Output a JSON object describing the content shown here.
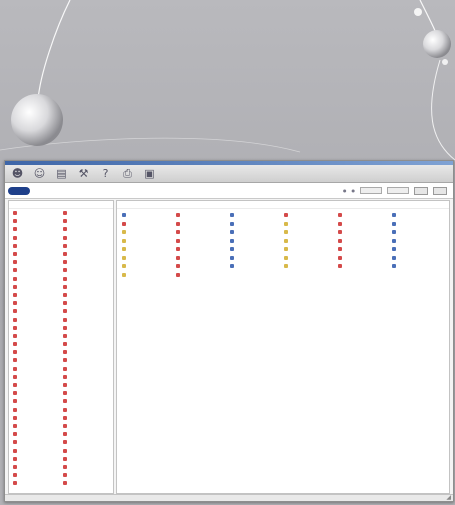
{
  "colors": {
    "red_icon": "#d44a4a",
    "blue_icon": "#4a6fb8",
    "yellow_icon": "#d8b94a",
    "title_bar": "#3e66a8"
  },
  "toolbar": {
    "icons": [
      "user-icon",
      "users-icon",
      "folder-icon",
      "tools-icon",
      "help-icon",
      "printer-icon",
      "building-icon"
    ]
  },
  "header": {
    "logo_text": "",
    "app_title": ""
  },
  "left_panel": {
    "col1": [
      {
        "color": "red"
      },
      {
        "color": "red"
      },
      {
        "color": "red"
      },
      {
        "color": "red"
      },
      {
        "color": "red"
      },
      {
        "color": "red"
      },
      {
        "color": "red"
      },
      {
        "color": "red"
      },
      {
        "color": "red"
      },
      {
        "color": "red"
      },
      {
        "color": "red"
      },
      {
        "color": "red"
      },
      {
        "color": "red"
      },
      {
        "color": "red"
      },
      {
        "color": "red"
      },
      {
        "color": "red"
      },
      {
        "color": "red"
      },
      {
        "color": "red"
      },
      {
        "color": "red"
      },
      {
        "color": "red"
      },
      {
        "color": "red"
      },
      {
        "color": "red"
      },
      {
        "color": "red"
      },
      {
        "color": "red"
      },
      {
        "color": "red"
      },
      {
        "color": "red"
      },
      {
        "color": "red"
      },
      {
        "color": "red"
      },
      {
        "color": "red"
      },
      {
        "color": "red"
      },
      {
        "color": "red"
      },
      {
        "color": "red"
      },
      {
        "color": "red"
      },
      {
        "color": "red"
      }
    ],
    "col2": [
      {
        "color": "red"
      },
      {
        "color": "red"
      },
      {
        "color": "red"
      },
      {
        "color": "red"
      },
      {
        "color": "red"
      },
      {
        "color": "red"
      },
      {
        "color": "red"
      },
      {
        "color": "red"
      },
      {
        "color": "red"
      },
      {
        "color": "red"
      },
      {
        "color": "red"
      },
      {
        "color": "red"
      },
      {
        "color": "red"
      },
      {
        "color": "red"
      },
      {
        "color": "red"
      },
      {
        "color": "red"
      },
      {
        "color": "red"
      },
      {
        "color": "red"
      },
      {
        "color": "red"
      },
      {
        "color": "red"
      },
      {
        "color": "red"
      },
      {
        "color": "red"
      },
      {
        "color": "red"
      },
      {
        "color": "red"
      },
      {
        "color": "red"
      },
      {
        "color": "red"
      },
      {
        "color": "red"
      },
      {
        "color": "red"
      },
      {
        "color": "red"
      },
      {
        "color": "red"
      },
      {
        "color": "red"
      },
      {
        "color": "red"
      },
      {
        "color": "red"
      },
      {
        "color": "red"
      }
    ]
  },
  "right_panel": {
    "items": [
      {
        "color": "blue"
      },
      {
        "color": "red"
      },
      {
        "color": "blue"
      },
      {
        "color": "red"
      },
      {
        "color": "red"
      },
      {
        "color": "blue"
      },
      {
        "color": "red"
      },
      {
        "color": "red"
      },
      {
        "color": "blue"
      },
      {
        "color": "yellow"
      },
      {
        "color": "red"
      },
      {
        "color": "blue"
      },
      {
        "color": "yellow"
      },
      {
        "color": "red"
      },
      {
        "color": "blue"
      },
      {
        "color": "yellow"
      },
      {
        "color": "red"
      },
      {
        "color": "blue"
      },
      {
        "color": "yellow"
      },
      {
        "color": "red"
      },
      {
        "color": "blue"
      },
      {
        "color": "yellow"
      },
      {
        "color": "red"
      },
      {
        "color": "blue"
      },
      {
        "color": "yellow"
      },
      {
        "color": "red"
      },
      {
        "color": "blue"
      },
      {
        "color": "yellow"
      },
      {
        "color": "red"
      },
      {
        "color": "blue"
      },
      {
        "color": "yellow"
      },
      {
        "color": "red"
      },
      {
        "color": "blue"
      },
      {
        "color": "yellow"
      },
      {
        "color": "red"
      },
      {
        "color": "blue"
      },
      {
        "color": "yellow"
      },
      {
        "color": "red"
      },
      {
        "color": "blue"
      },
      {
        "color": "yellow"
      },
      {
        "color": "red"
      },
      {
        "color": "blue"
      },
      {
        "color": "yellow"
      },
      {
        "color": "red"
      }
    ]
  }
}
